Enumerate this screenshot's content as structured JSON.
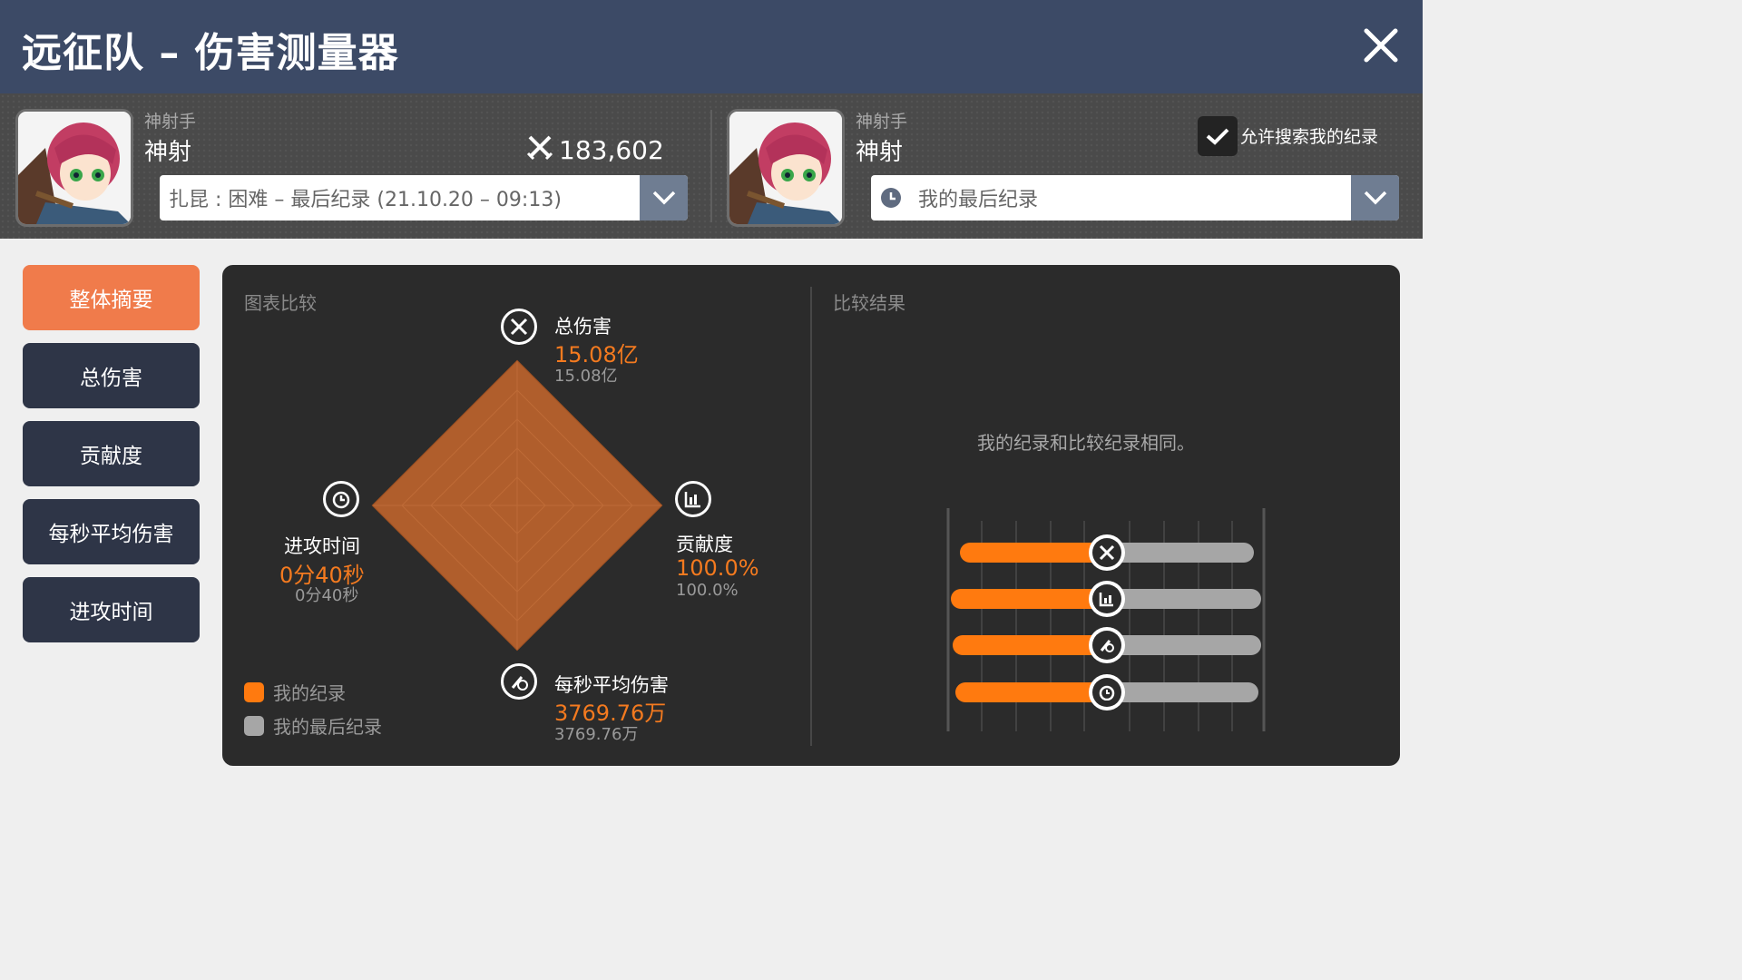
{
  "window": {
    "title": "远征队 – 伤害测量器"
  },
  "left_player": {
    "class": "神射手",
    "name": "神射",
    "combat_power": "183,602",
    "record_select": "扎昆 : 困难 – 最后纪录 (21.10.20 – 09:13)"
  },
  "right_player": {
    "class": "神射手",
    "name": "神射",
    "record_select": "我的最后纪录",
    "allow_search_label": "允许搜索我的纪录",
    "allow_search_checked": true
  },
  "menu": {
    "items": [
      {
        "label": "整体摘要",
        "active": true
      },
      {
        "label": "总伤害",
        "active": false
      },
      {
        "label": "贡献度",
        "active": false
      },
      {
        "label": "每秒平均伤害",
        "active": false
      },
      {
        "label": "进攻时间",
        "active": false
      }
    ]
  },
  "chart_panel": {
    "title": "图表比较",
    "metrics": {
      "total_damage": {
        "name": "总伤害",
        "mine": "15.08亿",
        "last": "15.08亿"
      },
      "contribution": {
        "name": "贡献度",
        "mine": "100.0%",
        "last": "100.0%"
      },
      "dps": {
        "name": "每秒平均伤害",
        "mine": "3769.76万",
        "last": "3769.76万"
      },
      "attack_time": {
        "name": "进攻时间",
        "mine": "0分40秒",
        "last": "0分40秒"
      }
    },
    "legend": {
      "mine": "我的纪录",
      "last": "我的最后纪录"
    }
  },
  "result_panel": {
    "title": "比较结果",
    "message": "我的纪录和比较纪录相同。"
  },
  "colors": {
    "accent_orange": "#ff7a0f",
    "radar_fill": "#b05e2c",
    "panel_bg": "#2b2b2b",
    "title_bar": "#3c4a66",
    "menu_active": "#f07b4b",
    "menu_inactive": "#2e3547"
  },
  "chart_data": {
    "type": "radar",
    "categories": [
      "总伤害",
      "贡献度",
      "每秒平均伤害",
      "进攻时间"
    ],
    "series": [
      {
        "name": "我的纪录",
        "values": [
          "15.08亿",
          "100.0%",
          "3769.76万",
          "0分40秒"
        ]
      },
      {
        "name": "我的最后纪录",
        "values": [
          "15.08亿",
          "100.0%",
          "3769.76万",
          "0分40秒"
        ]
      }
    ]
  }
}
